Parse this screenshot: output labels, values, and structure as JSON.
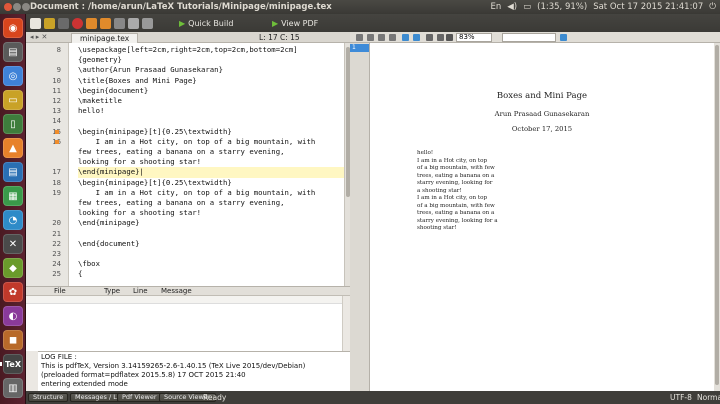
{
  "window": {
    "title": "Document : /home/arun/LaTeX Tutorials/Minipage/minipage.tex"
  },
  "tray": {
    "keyboard": "En",
    "volume_icon": "volume-icon",
    "battery": "(1:35, 91%)",
    "clock": "Sat Oct 17 2015 21:41:07"
  },
  "toolbar": {
    "quick_build": "Quick Build",
    "view_pdf": "View PDF"
  },
  "editor": {
    "tab_label": "minipage.tex",
    "cursor_pos": "L: 17 C: 15",
    "lines": [
      {
        "num": "8",
        "text": "\\usepackage[left=2cm,right=2cm,top=2cm,bottom=2cm]"
      },
      {
        "num": "",
        "text": "{geometry}"
      },
      {
        "num": "9",
        "text": "\\author{Arun Prasaad Gunasekaran}"
      },
      {
        "num": "10",
        "text": "\\title{Boxes and Mini Page}"
      },
      {
        "num": "11",
        "text": "\\begin{document}"
      },
      {
        "num": "12",
        "text": "\\maketitle"
      },
      {
        "num": "13",
        "text": "hello!"
      },
      {
        "num": "14",
        "text": ""
      },
      {
        "num": "15",
        "text": "\\begin{minipage}[t]{0.25\\textwidth}"
      },
      {
        "num": "16",
        "text": "    I am in a Hot city, on top of a big mountain, with"
      },
      {
        "num": "",
        "text": "few trees, eating a banana on a starry evening,"
      },
      {
        "num": "",
        "text": "looking for a shooting star!"
      },
      {
        "num": "17",
        "text": "\\end{minipage}|"
      },
      {
        "num": "18",
        "text": "\\begin{minipage}[t]{0.25\\textwidth}"
      },
      {
        "num": "19",
        "text": "    I am in a Hot city, on top of a big mountain, with"
      },
      {
        "num": "",
        "text": "few trees, eating a banana on a starry evening,"
      },
      {
        "num": "",
        "text": "looking for a shooting star!"
      },
      {
        "num": "20",
        "text": "\\end{minipage}"
      },
      {
        "num": "21",
        "text": ""
      },
      {
        "num": "22",
        "text": "\\end{document}"
      },
      {
        "num": "23",
        "text": ""
      },
      {
        "num": "24",
        "text": "\\fbox"
      },
      {
        "num": "25",
        "text": "{"
      }
    ]
  },
  "messages": {
    "columns": [
      "File",
      "Type",
      "Line",
      "Message"
    ]
  },
  "log": {
    "title": "LOG FILE :",
    "lines": [
      "This is pdfTeX, Version 3.14159265-2.6-1.40.15 (TeX Live 2015/dev/Debian)",
      "(preloaded format=pdflatex 2015.5.8) 17 OCT 2015 21:40",
      "entering extended mode"
    ]
  },
  "pdf": {
    "zoom": "83%",
    "page_number": "1",
    "title": "Boxes and Mini Page",
    "author": "Arun Prasaad Gunasekaran",
    "date": "October 17, 2015",
    "body": [
      "hello!",
      "I am in a Hot city, on top",
      "of a big mountain, with few",
      "trees, eating a banana on a",
      "starry evening, looking for",
      "a shooting star!",
      "I am in a Hot city, on top",
      "of a big mountain, with few",
      "trees, eating a banana on a",
      "starry evening, looking for a",
      "shooting star!"
    ]
  },
  "status": {
    "buttons": [
      "Structure",
      "Messages / Log",
      "Pdf Viewer",
      "Source Viewer"
    ],
    "ready": "Ready",
    "encoding": "UTF-8",
    "mode": "Normal Mode"
  }
}
